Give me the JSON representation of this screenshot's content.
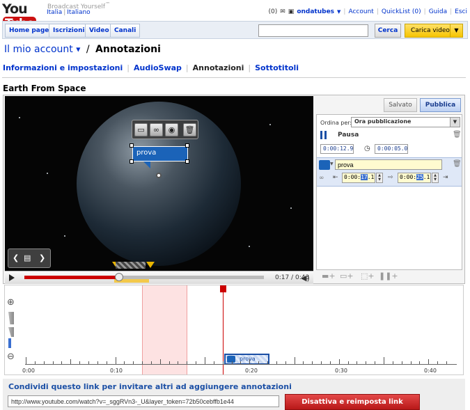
{
  "header": {
    "logo_text_1": "You",
    "logo_text_2": "Tube",
    "tagline": "Broadcast Yourself",
    "tm": "™",
    "locale_country": "Italia",
    "locale_language": "Italiano",
    "inbox_count": "(0)",
    "username": "ondatubes",
    "links": {
      "account": "Account",
      "quicklist": "QuickList (0)",
      "help": "Guida",
      "logout": "Esci"
    }
  },
  "nav": {
    "items": [
      "Home page",
      "Iscrizioni",
      "Video",
      "Canali"
    ],
    "search_placeholder": "",
    "search_button": "Cerca",
    "upload_button": "Carica video"
  },
  "account": {
    "link": "Il mio account",
    "separator": "/",
    "current": "Annotazioni"
  },
  "subnav": {
    "items": [
      "Informazioni e impostazioni",
      "AudioSwap",
      "Annotazioni",
      "Sottotitoli"
    ],
    "current_index": 2
  },
  "video": {
    "title": "Earth From Space",
    "annotation_text": "prova",
    "current_time": "0:17",
    "duration": "0:43",
    "timecode_display": "0:17 / 0:43",
    "progress_fraction": 0.395
  },
  "panel": {
    "saved_button": "Salvato",
    "publish_button": "Pubblica",
    "order_label": "Ordina per:",
    "order_value": "Ora pubblicazione",
    "pause": {
      "label": "Pausa",
      "start": "0:00:12.9",
      "duration": "0:00:05.0"
    },
    "annotation": {
      "text": "prova",
      "start_prefix": "0:00:",
      "start_hl": "17",
      "start_suffix": ".1",
      "end_prefix": "0:00:",
      "end_hl": "25",
      "end_suffix": ".1"
    }
  },
  "timeline": {
    "labels": [
      "0:00",
      "0:10",
      "0:20",
      "0:30",
      "0:40"
    ],
    "annotation_label": "prova"
  },
  "share": {
    "title": "Condividi questo link per invitare altri ad aggiungere annotazioni",
    "url": "http://www.youtube.com/watch?v=_sggRVn3-_U&layer_token=72b50cebffb1e44",
    "reset_button": "Disattiva e reimposta link"
  },
  "colors": {
    "brand_red": "#cc1111",
    "link_blue": "#0033cc",
    "annotation_blue": "#1b63b8",
    "upload_yellow": "#f6c400"
  }
}
